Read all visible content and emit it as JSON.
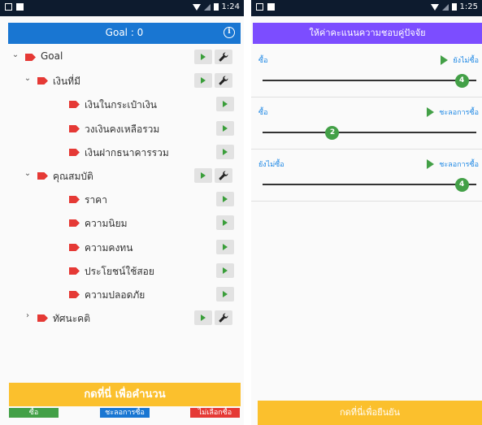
{
  "left": {
    "status": {
      "time": "1:24"
    },
    "header": {
      "title": "Goal : 0"
    },
    "tree": [
      {
        "label": "Goal",
        "chevron": "⌄",
        "level": 0,
        "wrench": true
      },
      {
        "label": "เงินที่มี",
        "chevron": "⌄",
        "level": 1,
        "wrench": true
      },
      {
        "label": "เงินในกระเป๋าเงิน",
        "chevron": "",
        "level": 2,
        "wrench": false
      },
      {
        "label": "วงเงินคงเหลือรวม",
        "chevron": "",
        "level": 2,
        "wrench": false
      },
      {
        "label": "เงินฝากธนาคารรวม",
        "chevron": "",
        "level": 2,
        "wrench": false
      },
      {
        "label": "คุณสมบัติ",
        "chevron": "⌄",
        "level": 1,
        "wrench": true
      },
      {
        "label": "ราคา",
        "chevron": "",
        "level": 2,
        "wrench": false
      },
      {
        "label": "ความนิยม",
        "chevron": "",
        "level": 2,
        "wrench": false
      },
      {
        "label": "ความคงทน",
        "chevron": "",
        "level": 2,
        "wrench": false
      },
      {
        "label": "ประโยชน์ใช้สอย",
        "chevron": "",
        "level": 2,
        "wrench": false
      },
      {
        "label": "ความปลอดภัย",
        "chevron": "",
        "level": 2,
        "wrench": false
      },
      {
        "label": "ทัศนะคติ",
        "chevron": "›",
        "level": 1,
        "wrench": true
      }
    ],
    "calc_button": "กดที่นี่ เพื่อคำนวน",
    "legend": {
      "buy": "ซื้อ",
      "delay": "ชะลอการซื้อ",
      "nobuy": "ไม่เลือกซื้อ"
    }
  },
  "right": {
    "status": {
      "time": "1:25"
    },
    "header": {
      "title": "ให้ค่าคะแนนความชอบคู่ปัจจัย"
    },
    "pairs": [
      {
        "left": "ซื้อ",
        "right": "ยังไม่ซื้อ",
        "value": 4
      },
      {
        "left": "ซื้อ",
        "right": "ชะลอการซื้อ",
        "value": 2
      },
      {
        "left": "ยังไม่ซื้อ",
        "right": "ชะลอการซื้อ",
        "value": 4
      }
    ],
    "confirm_button": "กดที่นี่เพื่อยืนยัน"
  },
  "colors": {
    "header_blue": "#1976d2",
    "header_purple": "#7c4dff",
    "accent_yellow": "#fbc02d",
    "buy_green": "#43a047",
    "nobuy_red": "#e53935",
    "tag_red": "#e53935"
  },
  "icons": {
    "tag": "tag-icon",
    "play": "play-icon",
    "wrench": "wrench-icon",
    "info": "info-icon"
  }
}
